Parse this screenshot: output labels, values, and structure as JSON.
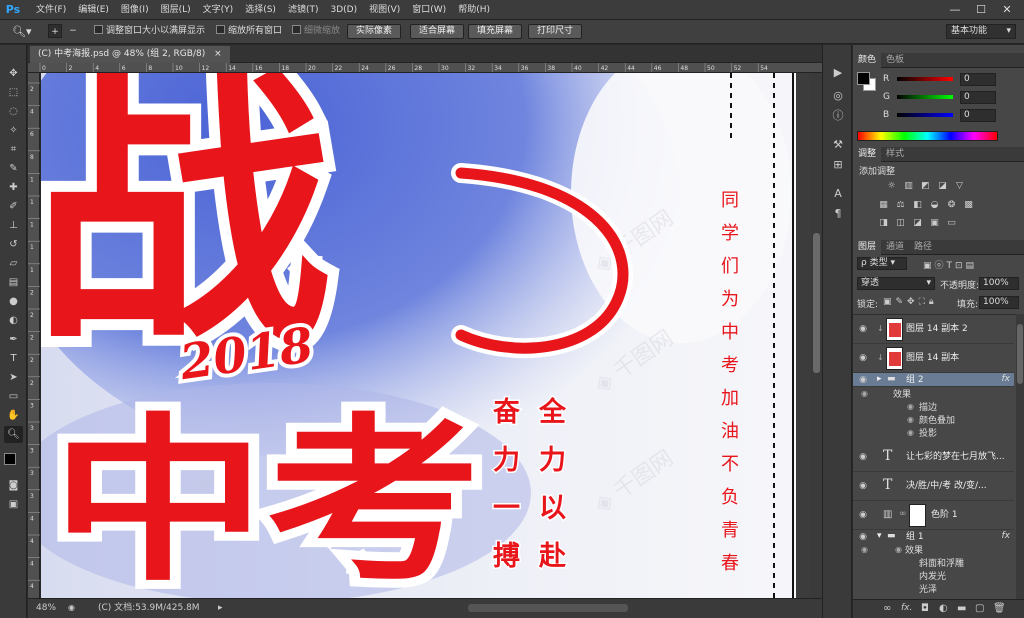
{
  "app": {
    "logo": "Ps"
  },
  "menubar": {
    "items": [
      "文件(F)",
      "编辑(E)",
      "图像(I)",
      "图层(L)",
      "文字(Y)",
      "选择(S)",
      "滤镜(T)",
      "3D(D)",
      "视图(V)",
      "窗口(W)",
      "帮助(H)"
    ],
    "minimize": "—",
    "restore": "☐",
    "close": "✕"
  },
  "options": {
    "resize_windows": "调整窗口大小以满屏显示",
    "zoom_all": "缩放所有窗口",
    "scrubby_zoom": "细微缩放",
    "actual_pixels": "实际像素",
    "fit_screen": "适合屏幕",
    "fill_screen": "填充屏幕",
    "print_size": "打印尺寸",
    "workspace": "基本功能"
  },
  "document": {
    "tab_title": "(C) 中考海报.psd @ 48% (组 2, RGB/8)",
    "close": "×",
    "zoom": "48%",
    "doc_size": "(C) 文档:53.9M/425.8M",
    "ruler_h": [
      "0",
      "2",
      "4",
      "6",
      "8",
      "10",
      "12",
      "14",
      "16",
      "18",
      "20",
      "22",
      "24",
      "26",
      "28",
      "30",
      "32",
      "34",
      "36",
      "38",
      "40",
      "42",
      "44",
      "46",
      "48",
      "50",
      "52",
      "54"
    ],
    "ruler_v": [
      "2",
      "4",
      "6",
      "8",
      "1",
      "1",
      "1",
      "1",
      "1",
      "2",
      "2",
      "2",
      "2",
      "2",
      "3",
      "3",
      "3",
      "3",
      "3",
      "4",
      "4",
      "4",
      "4"
    ]
  },
  "poster": {
    "big_glyph": "战",
    "year": "2018",
    "title": "中考",
    "slogan_col1": [
      "全",
      "力",
      "以",
      "赴"
    ],
    "slogan_col2": [
      "奋",
      "力",
      "一",
      "搏"
    ],
    "vertical_text": [
      "同",
      "学",
      "们",
      "为",
      "中",
      "考",
      "加",
      "油",
      "不",
      "负",
      "青",
      "春"
    ]
  },
  "panels": {
    "color": {
      "tabs": [
        "颜色",
        "色板"
      ],
      "r_label": "R",
      "g_label": "G",
      "b_label": "B",
      "r": "0",
      "g": "0",
      "b": "0"
    },
    "adjust": {
      "tabs": [
        "调整",
        "样式"
      ],
      "title": "添加调整"
    },
    "layers": {
      "tabs": [
        "图层",
        "通道",
        "路径"
      ],
      "filter": "类型",
      "blend": "穿透",
      "opacity_label": "不透明度:",
      "opacity": "100%",
      "lock_label": "锁定:",
      "fill_label": "填充:",
      "fill": "100%",
      "items": [
        {
          "name": "图层 14 副本 2"
        },
        {
          "name": "图层 14 副本"
        },
        {
          "name": "组 2",
          "fx": "fx"
        },
        {
          "name": "让七彩的梦在七月放飞..."
        },
        {
          "name": "决/胜/中/考    改/变/..."
        },
        {
          "name": "色阶 1"
        },
        {
          "name": "组 1",
          "fx": "fx"
        }
      ],
      "group2_effects": [
        "效果",
        "描边",
        "颜色叠加",
        "投影"
      ],
      "group1_effects": [
        "效果",
        "斜面和浮雕",
        "内发光",
        "光泽"
      ],
      "bottom_icons": [
        "link-icon",
        "fx-icon",
        "mask-icon",
        "adjustment-icon",
        "folder-icon",
        "new-layer-icon",
        "trash-icon"
      ]
    }
  },
  "colors": {
    "accent_red": "#e8151b",
    "selection": "#6a7c93",
    "panel_bg": "#474747",
    "watermark": "#c9c9d6"
  }
}
